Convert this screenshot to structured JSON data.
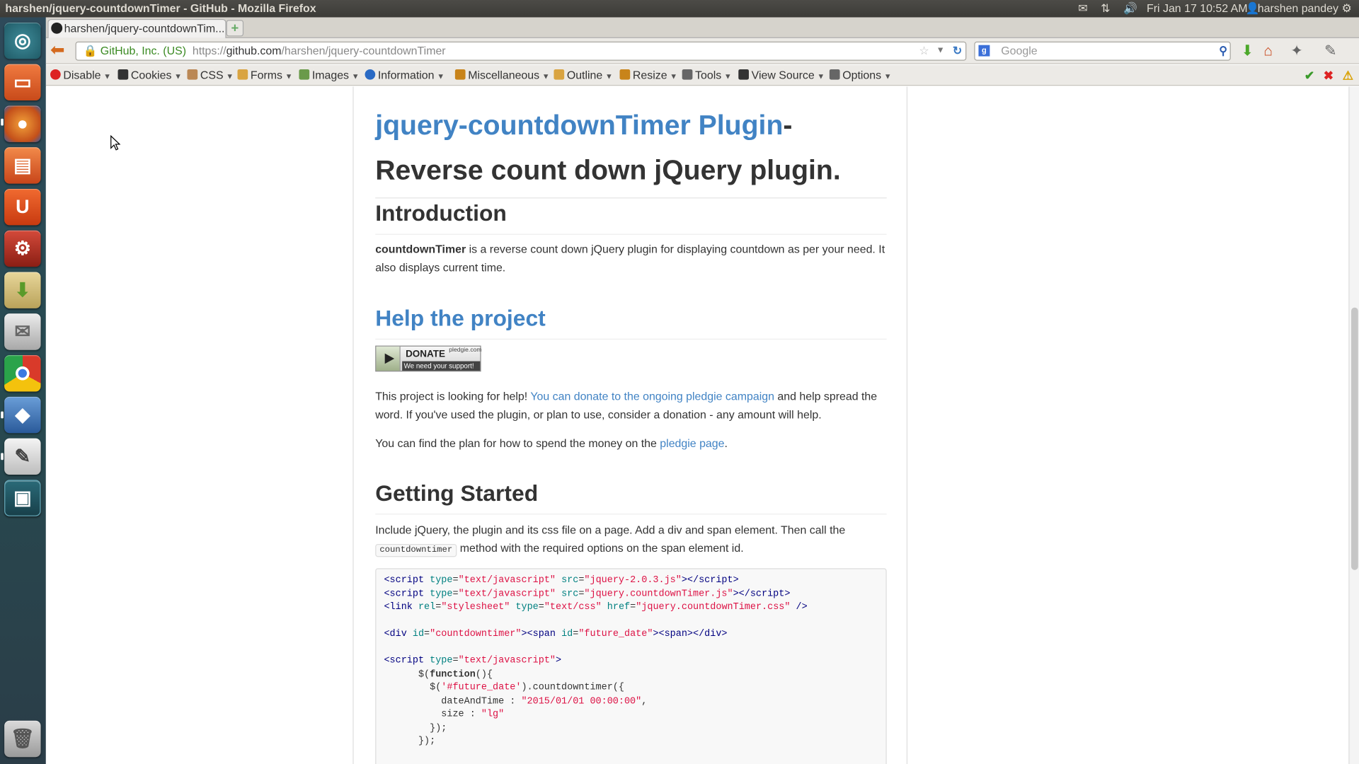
{
  "window": {
    "title": "harshen/jquery-countdownTimer - GitHub - Mozilla Firefox",
    "clock": "Fri Jan 17 10:52 AM",
    "user": "harshen pandey"
  },
  "launcher": {
    "items": [
      "dash-home",
      "files",
      "firefox",
      "software-center",
      "ubuntu-one",
      "system-settings",
      "archive-manager",
      "mail",
      "chrome",
      "virtualbox",
      "text-editor",
      "workspace-switcher",
      "trash"
    ]
  },
  "browser": {
    "tab_title": "harshen/jquery-countdownTim...",
    "new_tab_glyph": "+",
    "site_identity": "GitHub, Inc. (US)",
    "url_prefix": "https://",
    "url_host": "github.com",
    "url_path": "/harshen/jquery-countdownTimer",
    "search_placeholder": "Google"
  },
  "devbar": {
    "menus": [
      "Disable",
      "Cookies",
      "CSS",
      "Forms",
      "Images",
      "Information",
      "Miscellaneous",
      "Outline",
      "Resize",
      "Tools",
      "View Source",
      "Options"
    ]
  },
  "page": {
    "title_link": "jquery-countdownTimer Plugin",
    "title_rest": "- Reverse count down jQuery plugin.",
    "intro_heading": "Introduction",
    "intro_strong": "countdownTimer",
    "intro_text": " is a reverse count down jQuery plugin for displaying countdown as per your need. It also displays current time.",
    "help_heading": "Help the project",
    "donate": {
      "label": "DONATE",
      "site": "pledgie.com",
      "sub": "We need your support!"
    },
    "help_p1_a": "This project is looking for help! ",
    "help_p1_link": "You can donate to the ongoing pledgie campaign",
    "help_p1_b": " and help spread the word. If you've used the plugin, or plan to use, consider a donation - any amount will help.",
    "help_p2_a": "You can find the plan for how to spend the money on the ",
    "help_p2_link": "pledgie page",
    "help_p2_b": ".",
    "start_heading": "Getting Started",
    "start_p_a": "Include jQuery, the plugin and its css file on a page. Add a div and span element. Then call the ",
    "start_code": "countdowntimer",
    "start_p_b": " method with the required options on the span element id.",
    "code": {
      "l1_src": "\"jquery-2.0.3.js\"",
      "l2_src": "\"jquery.countdownTimer.js\"",
      "l3_href": "\"jquery.countdownTimer.css\"",
      "type_js": "\"text/javascript\"",
      "type_css": "\"text/css\"",
      "rel": "\"stylesheet\"",
      "div_id": "\"countdowntimer\"",
      "span_id": "\"future_date\"",
      "selector": "'#future_date'",
      "date_value": "\"2015/01/01 00:00:00\"",
      "size_value": "\"lg\""
    }
  },
  "colors": {
    "link": "#4183c4",
    "launcher_bg": "#2e4a5a",
    "topbar_bg": "#3c3b37"
  }
}
